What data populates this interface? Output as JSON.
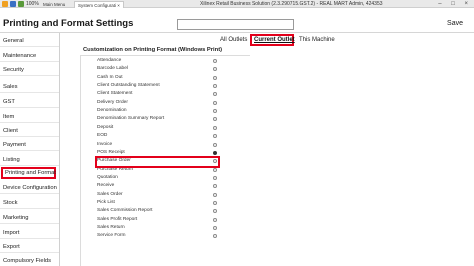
{
  "titlebar": {
    "zoom": "100%",
    "main_menu_tab": "Main Menu",
    "system_config_tab": "System Configurati ×",
    "window_title": "Xilinex Retail Business Solution (2.3.290715.GST.2) - REAL MART Admin, 424353",
    "controls": "– □ ×"
  },
  "header": {
    "title": "Printing and Format Settings",
    "search_value": "",
    "save_label": "Save"
  },
  "sidebar": {
    "items": [
      {
        "label": "General"
      },
      {
        "label": "Maintenance"
      },
      {
        "label": "Security"
      },
      {
        "label": "Sales"
      },
      {
        "label": "GST"
      },
      {
        "label": "Item"
      },
      {
        "label": "Client"
      },
      {
        "label": "Payment"
      },
      {
        "label": "Listing"
      },
      {
        "label": "Printing and Format"
      },
      {
        "label": "Device Configuration"
      },
      {
        "label": "Stock"
      },
      {
        "label": "Marketing"
      },
      {
        "label": "Import"
      },
      {
        "label": "Export"
      },
      {
        "label": "Compulsory Fields"
      }
    ],
    "selected": "Printing and Format"
  },
  "tabs": {
    "all_outlets": "All Outlets",
    "current_outlet": "Current Outlet",
    "this_machine": "This Machine"
  },
  "panel": {
    "title": "Customization on Printing Format (Windows Print)",
    "rows": [
      {
        "label": "Attendance",
        "checked": false
      },
      {
        "label": "Barcode Label",
        "checked": false
      },
      {
        "label": "Cash In Out",
        "checked": false
      },
      {
        "label": "Client Outstanding Statement",
        "checked": false
      },
      {
        "label": "Client Statement",
        "checked": false
      },
      {
        "label": "Delivery Order",
        "checked": false
      },
      {
        "label": "Denomination",
        "checked": false
      },
      {
        "label": "Denomination Summary Report",
        "checked": false
      },
      {
        "label": "Deposit",
        "checked": false
      },
      {
        "label": "EOD",
        "checked": false
      },
      {
        "label": "Invoice",
        "checked": false
      },
      {
        "label": "POS Receipt",
        "checked": true
      },
      {
        "label": "Purchase Order",
        "checked": false
      },
      {
        "label": "Purchase Return",
        "checked": false
      },
      {
        "label": "Quotation",
        "checked": false
      },
      {
        "label": "Receive",
        "checked": false
      },
      {
        "label": "Sales Order",
        "checked": false
      },
      {
        "label": "Pick List",
        "checked": false
      },
      {
        "label": "Sales Commission Report",
        "checked": false
      },
      {
        "label": "Sales Profit Report",
        "checked": false
      },
      {
        "label": "Sales Return",
        "checked": false
      },
      {
        "label": "Service Form",
        "checked": false
      }
    ]
  },
  "colors": {
    "highlight": "#e3001b",
    "accent_orange": "#f0a020",
    "accent_blue": "#3a6fc4"
  }
}
